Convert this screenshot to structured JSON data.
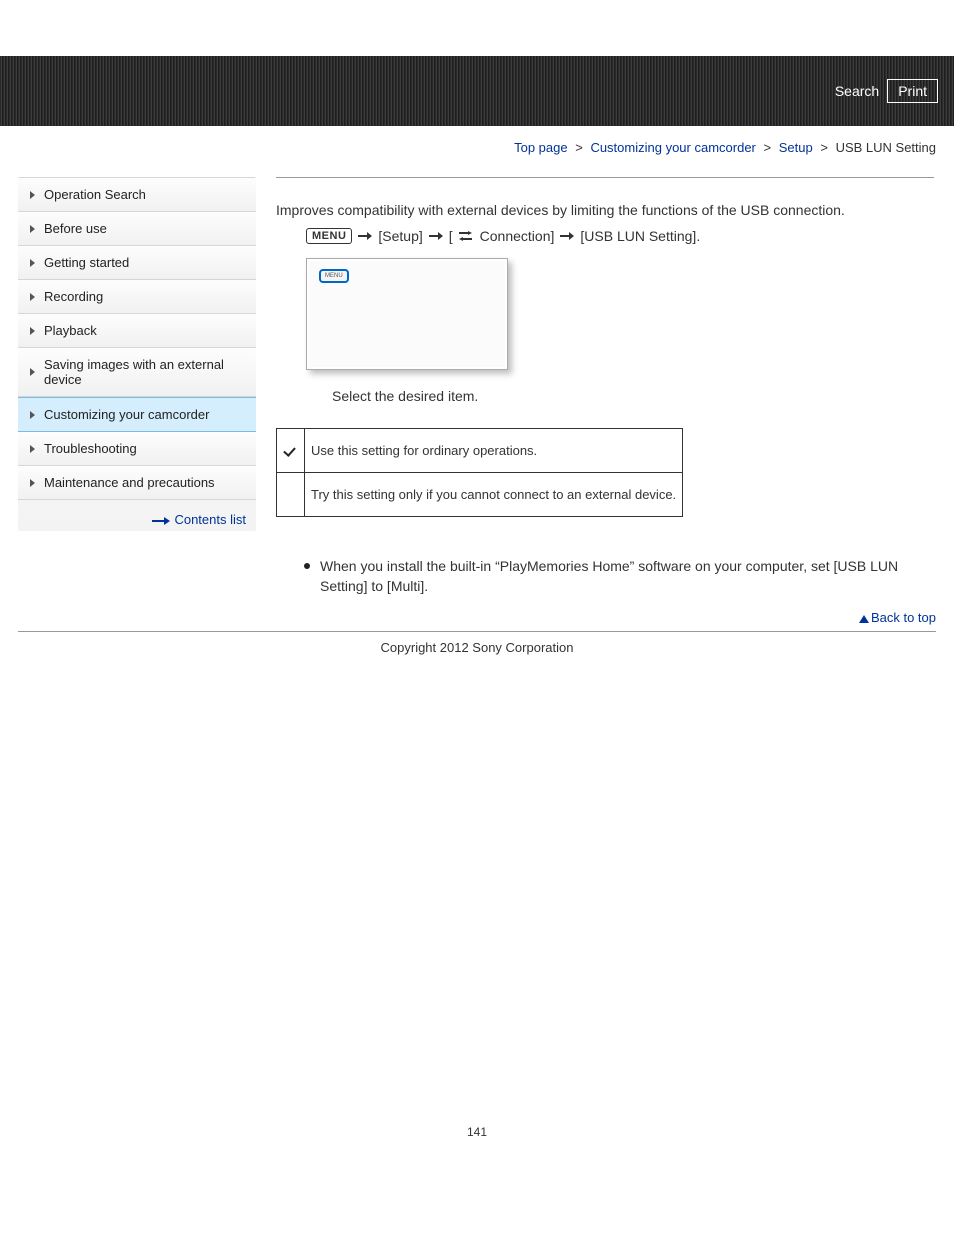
{
  "header": {
    "search": "Search",
    "print": "Print"
  },
  "breadcrumb": {
    "parts": [
      "Top page",
      "Customizing your camcorder",
      "Setup"
    ],
    "current": "USB LUN Setting",
    "sep": ">"
  },
  "sidebar": {
    "items": [
      {
        "label": "Operation Search"
      },
      {
        "label": "Before use"
      },
      {
        "label": "Getting started"
      },
      {
        "label": "Recording"
      },
      {
        "label": "Playback"
      },
      {
        "label": "Saving images with an external device"
      },
      {
        "label": "Customizing your camcorder"
      },
      {
        "label": "Troubleshooting"
      },
      {
        "label": "Maintenance and precautions"
      }
    ],
    "active_index": 6,
    "contents_list": "Contents list"
  },
  "content": {
    "intro": "Improves compatibility with external devices by limiting the functions of the USB connection.",
    "menu_button": "MENU",
    "path_setup": "[Setup]",
    "path_connection_prefix": "[",
    "path_connection": "Connection]",
    "path_final": "[USB LUN Setting].",
    "screen_label": "MENU",
    "instruction": "Select the desired item.",
    "table": {
      "row1_desc": "Use this setting for ordinary operations.",
      "row2_desc": "Try this setting only if you cannot connect to an external device."
    },
    "notes": [
      "When you install the built-in “PlayMemories Home” software on your computer, set [USB LUN Setting] to [Multi]."
    ]
  },
  "footer": {
    "back_to_top": "Back to top",
    "copyright": "Copyright 2012 Sony Corporation",
    "page_number": "141"
  }
}
